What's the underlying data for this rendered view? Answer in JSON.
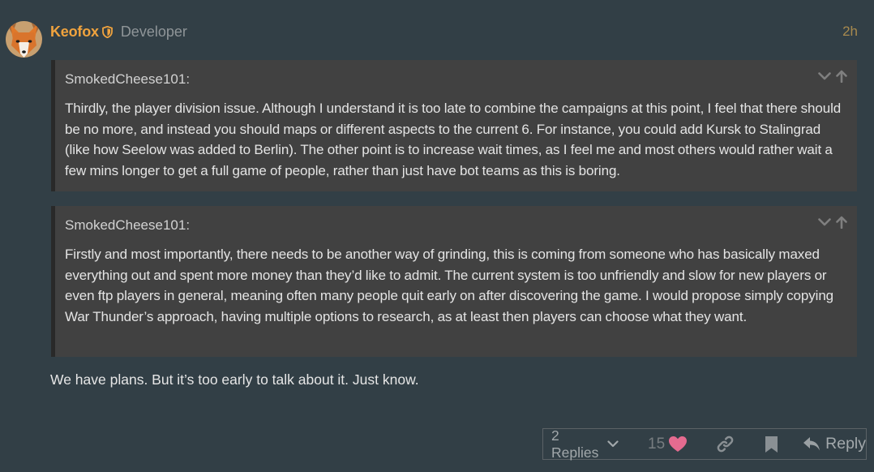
{
  "post": {
    "username": "Keofox",
    "user_title": "Developer",
    "date": "2h",
    "quotes": [
      {
        "author": "SmokedCheese101:",
        "text": "Thirdly, the player division issue. Although I understand it is too late to combine the campaigns at this point, I feel that there should be no more, and instead you should maps or different aspects to the current 6. For instance, you could add Kursk to Stalingrad (like how Seelow was added to Berlin). The other point is to increase wait times, as I feel me and most others would rather wait a few mins longer to get a full game of people, rather than just have bot teams as this is boring."
      },
      {
        "author": "SmokedCheese101:",
        "text": "Firstly and most importantly, there needs to be another way of grinding, this is coming from someone who has basically maxed everything out and spent more money than they’d like to admit. The current system is too unfriendly and slow for new players or even ftp players in general, meaning often many people quit early on after discovering the game. I would propose simply copying War Thunder’s approach, having multiple options to research, as at least then players can choose what they want."
      }
    ],
    "body": "We have plans. But it’s too early to talk about it. Just know."
  },
  "actions": {
    "replies_label": "2 Replies",
    "like_count": "15",
    "reply_label": "Reply"
  },
  "icons": {
    "moderator": "shield-icon",
    "expand": "chevron-down-icon",
    "goto": "arrow-up-icon",
    "like": "heart-icon",
    "share": "link-icon",
    "bookmark": "bookmark-icon",
    "reply": "reply-icon"
  },
  "colors": {
    "background": "#323f46",
    "username": "#f0a33e",
    "quote_bg": "#414141",
    "heart": "#e56b90"
  }
}
